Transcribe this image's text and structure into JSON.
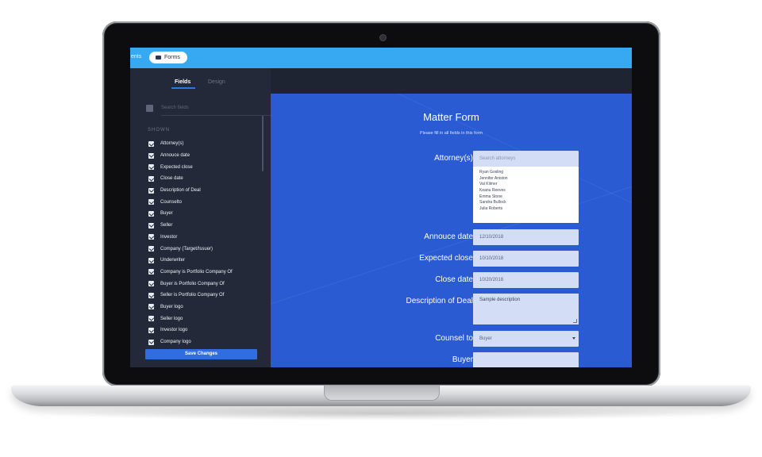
{
  "topbar": {
    "crumb": "ents",
    "forms_tab": "Forms"
  },
  "sidebar": {
    "tabs": [
      {
        "label": "Fields"
      },
      {
        "label": "Design"
      }
    ],
    "search_placeholder": "Search fields",
    "section_label": "SHOWN",
    "fields": [
      {
        "label": "Attorney(s)",
        "checked": true
      },
      {
        "label": "Annouce date",
        "checked": true
      },
      {
        "label": "Expected close",
        "checked": true
      },
      {
        "label": "Close date",
        "checked": true
      },
      {
        "label": "Description of Deal",
        "checked": true
      },
      {
        "label": "Counselto",
        "checked": true
      },
      {
        "label": "Buyer",
        "checked": true
      },
      {
        "label": "Seller",
        "checked": true
      },
      {
        "label": "Investor",
        "checked": true
      },
      {
        "label": "Company (Target/Issuer)",
        "checked": true
      },
      {
        "label": "Underwriter",
        "checked": true
      },
      {
        "label": "Company is Portfolio Company Of",
        "checked": true
      },
      {
        "label": "Buyer is Portfolio Company Of",
        "checked": true
      },
      {
        "label": "Seller is Portfolio Company Of",
        "checked": true
      },
      {
        "label": "Buyer logo",
        "checked": true
      },
      {
        "label": "Seller logo",
        "checked": true
      },
      {
        "label": "Investor logo",
        "checked": true
      },
      {
        "label": "Company logo",
        "checked": true
      }
    ],
    "save_label": "Save Changes"
  },
  "form": {
    "title": "Matter Form",
    "subtitle": "Please fill in all fields in this form",
    "attorney": {
      "label": "Attorney(s)",
      "placeholder": "Search attorneys",
      "options": [
        "Ryan Gosling",
        "Jennifer Aniston",
        "Val Kilmer",
        "Keanu Reeves",
        "Emma Stone",
        "Sandra Bullock",
        "Julia Roberts"
      ]
    },
    "announce_date": {
      "label": "Annouce date",
      "value": "12/10/2018"
    },
    "expected_close": {
      "label": "Expected close",
      "value": "10/10/2018"
    },
    "close_date": {
      "label": "Close date",
      "value": "10/20/2018"
    },
    "description": {
      "label": "Description of Deal",
      "value": "Sample description"
    },
    "counsel_to": {
      "label": "Counsel to",
      "value": "Buyer"
    },
    "buyer": {
      "label": "Buyer",
      "value": ""
    }
  }
}
